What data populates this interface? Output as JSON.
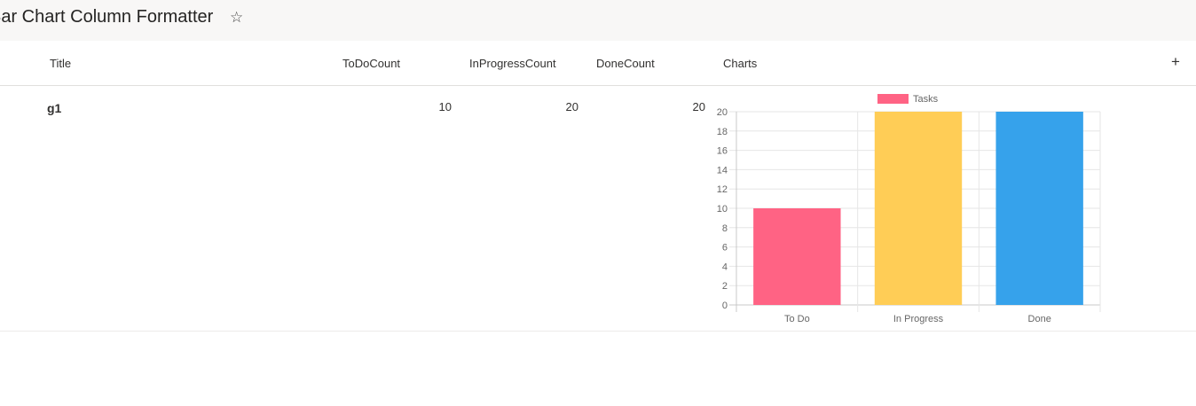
{
  "page": {
    "title": "Bar Chart Column Formatter",
    "favorite_icon": "☆"
  },
  "columns": {
    "title": "Title",
    "todo": "ToDoCount",
    "inprogress": "InProgressCount",
    "done": "DoneCount",
    "charts": "Charts",
    "add_icon": "+",
    "more_icon": "⋮"
  },
  "rows": [
    {
      "title": "g1",
      "todo": "10",
      "inprogress": "20",
      "done": "20"
    }
  ],
  "chart_data": {
    "type": "bar",
    "categories": [
      "To Do",
      "In Progress",
      "Done"
    ],
    "series": [
      {
        "name": "Tasks",
        "values": [
          10,
          20,
          20
        ]
      }
    ],
    "colors": [
      "#ff6384",
      "#ffcd56",
      "#36a2eb"
    ],
    "legend_color": "#ff6384",
    "ylim": [
      0,
      20
    ],
    "yticks": [
      0,
      2,
      4,
      6,
      8,
      10,
      12,
      14,
      16,
      18,
      20
    ],
    "grid": true,
    "legend": "top-center",
    "title": "",
    "xlabel": "",
    "ylabel": ""
  }
}
